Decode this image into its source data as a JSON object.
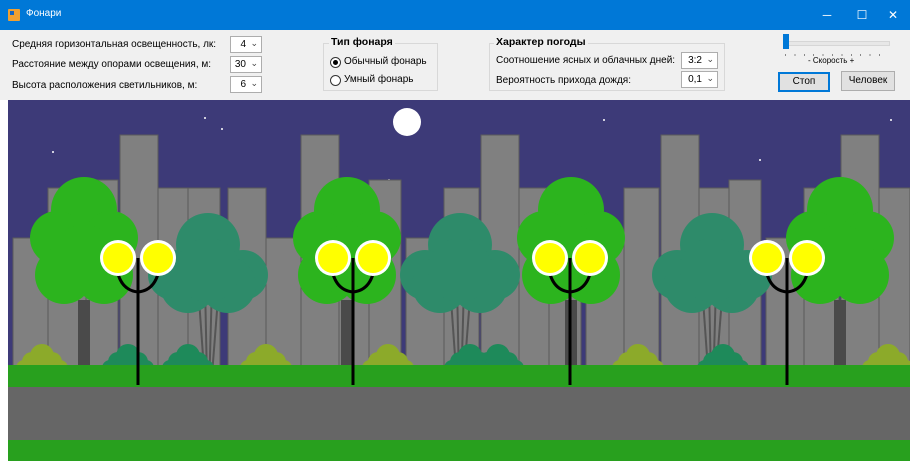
{
  "window": {
    "title": "Фонари",
    "minimize": "─",
    "maximize": "☐",
    "close": "✕",
    "icon": "lamp-app-icon"
  },
  "controls": {
    "illuminance_label": "Средняя горизонтальная освещенность, лк:",
    "illuminance_value": "4",
    "spacing_label": "Расстояние между опорами освещения, м:",
    "spacing_value": "30",
    "height_label": "Высота расположения светильников, м:",
    "height_value": "6"
  },
  "lamp_type": {
    "title": "Тип фонаря",
    "options": [
      {
        "label": "Обычный фонарь",
        "checked": true
      },
      {
        "label": "Умный фонарь",
        "checked": false
      }
    ]
  },
  "weather": {
    "title": "Характер погоды",
    "ratio_label": "Соотношение ясных и облачных дней:",
    "ratio_value": "3:2",
    "rain_label": "Вероятность прихода дождя:",
    "rain_value": "0,1"
  },
  "speed": {
    "label": "-  Скорость  +",
    "value_fraction": 0.0
  },
  "buttons": {
    "stop": "Стоп",
    "person": "Человек"
  },
  "scene": {
    "sky_color": "#3d3a78",
    "building_color": "#808080",
    "tree_color": "#2cb41e",
    "bush_color": "#2e8b6a",
    "lamp_light_color": "#ffff00",
    "grass_color": "#28a01e",
    "road_color": "#666666",
    "moon_color": "#ffffff",
    "lamp_count": 4,
    "lamps_on": true
  }
}
